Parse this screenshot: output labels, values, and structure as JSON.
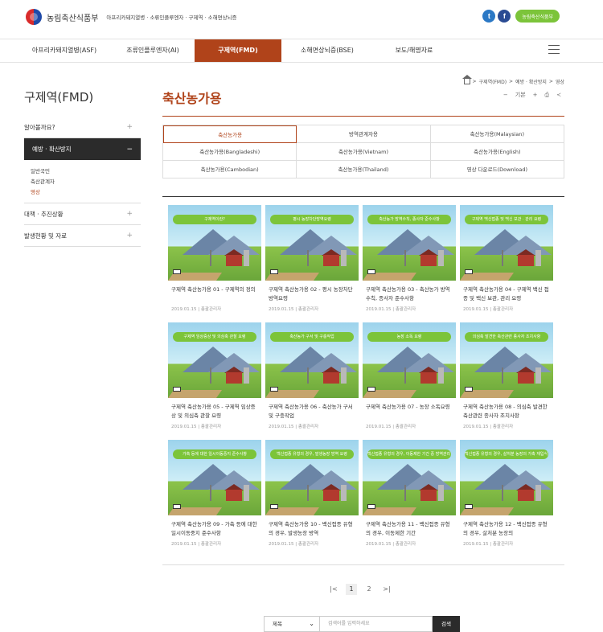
{
  "header": {
    "logo_text": "농림축산식품부",
    "subtitle": "아프리카돼지열병 · 소류인플루엔자 · 구제역 · 소해면상뇌증",
    "social": {
      "twitter": "t",
      "facebook": "f"
    },
    "badge": "농림축산식품부"
  },
  "nav": {
    "items": [
      "아프리카돼지열병(ASF)",
      "조류인플루엔자(AI)",
      "구제역(FMD)",
      "소해면상뇌증(BSE)",
      "보도/해명자료"
    ],
    "active": 2
  },
  "sidebar": {
    "title": "구제역(FMD)",
    "items": [
      {
        "label": "알아볼까요?",
        "toggle": "+"
      },
      {
        "label": "예방 · 확산방지",
        "toggle": "−",
        "sub": [
          "일반국민",
          "축산관계자",
          "영상"
        ]
      },
      {
        "label": "대책 · 추진상황",
        "toggle": "+"
      },
      {
        "label": "발생현황 및 자료",
        "toggle": "+"
      }
    ]
  },
  "breadcrumb": [
    "구제역(FMD)",
    "예방 · 확산방지",
    "영상"
  ],
  "page_title": "축산농가용",
  "tools": {
    "minus": "−",
    "zoom": "기본",
    "plus": "+",
    "print": "⎙",
    "share": "≺"
  },
  "tabs": [
    "축산농가용",
    "방역관계자용",
    "축산농가용(Malaysian)",
    "축산농가용(Bangladeshi)",
    "축산농가용(Vietnam)",
    "축산농가용(English)",
    "축산농가용(Cambodian)",
    "축산농가용(Thailand)",
    "영상 다운로드(Download)"
  ],
  "cards": [
    {
      "banner": "구제역이란?",
      "title": "구제역 축산농가용 01 - 구제역의 정의",
      "date": "2019.01.15",
      "author": "총괄관리자"
    },
    {
      "banner": "평시 농장차단방역요령",
      "title": "구제역 축산농가용 02 - 평시 농장차단방역요령",
      "date": "2019.01.15",
      "author": "총괄관리자"
    },
    {
      "banner": "축산농가 방역수칙, 종사자 준수사항",
      "title": "구제역 축산농가용 03 - 축산농가 방역수칙, 종사자 준수사항",
      "date": "2019.01.15",
      "author": "총괄관리자"
    },
    {
      "banner": "구제역 백신접종 및 백신 보관 · 관리 요령",
      "title": "구제역 축산농가용 04 - 구제역 백신 접종 및 백신 보관, 관리 요령",
      "date": "2019.01.15",
      "author": "총괄관리자"
    },
    {
      "banner": "구제역 임상증상 및 의심축 관찰 요령",
      "title": "구제역 축산농가용 05 - 구제역 임상증상 및 의심축 관찰 요령",
      "date": "2019.01.15",
      "author": "총괄관리자"
    },
    {
      "banner": "축산농가 구서 및 구충작업",
      "title": "구제역 축산농가용 06 - 축산농가 구서 및 구충작업",
      "date": "2019.01.15",
      "author": "총괄관리자"
    },
    {
      "banner": "농장 소독 요령",
      "title": "구제역 축산농가용 07 - 농장 소독요령",
      "date": "2019.01.15",
      "author": "총괄관리자"
    },
    {
      "banner": "의심축 발견한 축산관련 종사자 조치사항",
      "title": "구제역 축산농가용 08 - 의심축 발견한 축산관련 종사자 조치사항",
      "date": "2019.01.15",
      "author": "총괄관리자"
    },
    {
      "banner": "가축 등에 대한 일시이동중지 준수사항",
      "title": "구제역 축산농가용 09 - 가축 등에 대한 일시이동중지 준수사항",
      "date": "2019.01.15",
      "author": "총괄관리자"
    },
    {
      "banner": "백신접종 유형의 경우, 발생농장 방역 요령",
      "title": "구제역 축산농가용 10 - 백신접종 유형의 경우, 발생농장 방역",
      "date": "2019.01.15",
      "author": "총괄관리자"
    },
    {
      "banner": "백신접종 유형의 경우, 이동제한 기간 중 방역관리 요령",
      "title": "구제역 축산농가용 11 - 백신접종 유형의 경우, 이동제한 기간",
      "date": "2019.01.15",
      "author": "총괄관리자"
    },
    {
      "banner": "백신접종 유형의 경우, 살처분 농장의 가축 재입식 요령",
      "title": "구제역 축산농가용 12 - 백신접종 유형의 경우, 살처분 농장의",
      "date": "2019.01.15",
      "author": "총괄관리자"
    }
  ],
  "pager": {
    "first": "|<",
    "pages": [
      "1",
      "2"
    ],
    "current": "1",
    "next": ">|"
  },
  "search": {
    "field": "제목",
    "placeholder": "검색어를 입력하세요",
    "button": "검색"
  }
}
